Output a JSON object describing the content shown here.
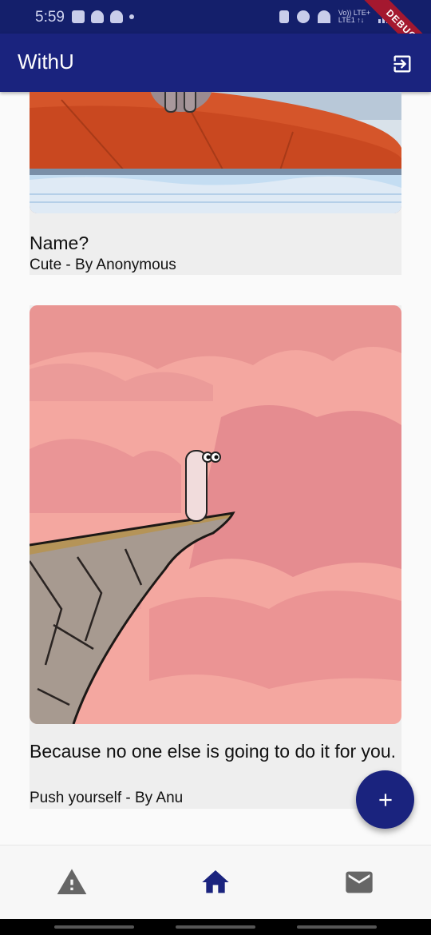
{
  "status_bar": {
    "time": "5:59",
    "network_line1": "Vo)) LTE+",
    "network_line2": "LTE1 ↑↓"
  },
  "debug_banner": "DEBUG",
  "app_bar": {
    "title": "WithU",
    "logout_icon": "logout-icon"
  },
  "posts": [
    {
      "title": "Name?",
      "subtitle": "Cute - By Anonymous",
      "image": "cartoon-creature-on-red-ledge"
    },
    {
      "title": "Because no one else is going to do it for you.",
      "subtitle": "Push yourself  - By Anu",
      "image": "cartoon-creature-on-cliff-pink-sky"
    }
  ],
  "fab": {
    "icon": "plus-icon"
  },
  "bottom_nav": {
    "items": [
      {
        "icon": "warning-icon",
        "active": false
      },
      {
        "icon": "home-icon",
        "active": true
      },
      {
        "icon": "mail-icon",
        "active": false
      }
    ],
    "active_color": "#1a237e",
    "inactive_color": "#666666"
  },
  "colors": {
    "primary": "#1a237e",
    "status_bar": "#141f6b",
    "card_background": "#eeeeee"
  }
}
